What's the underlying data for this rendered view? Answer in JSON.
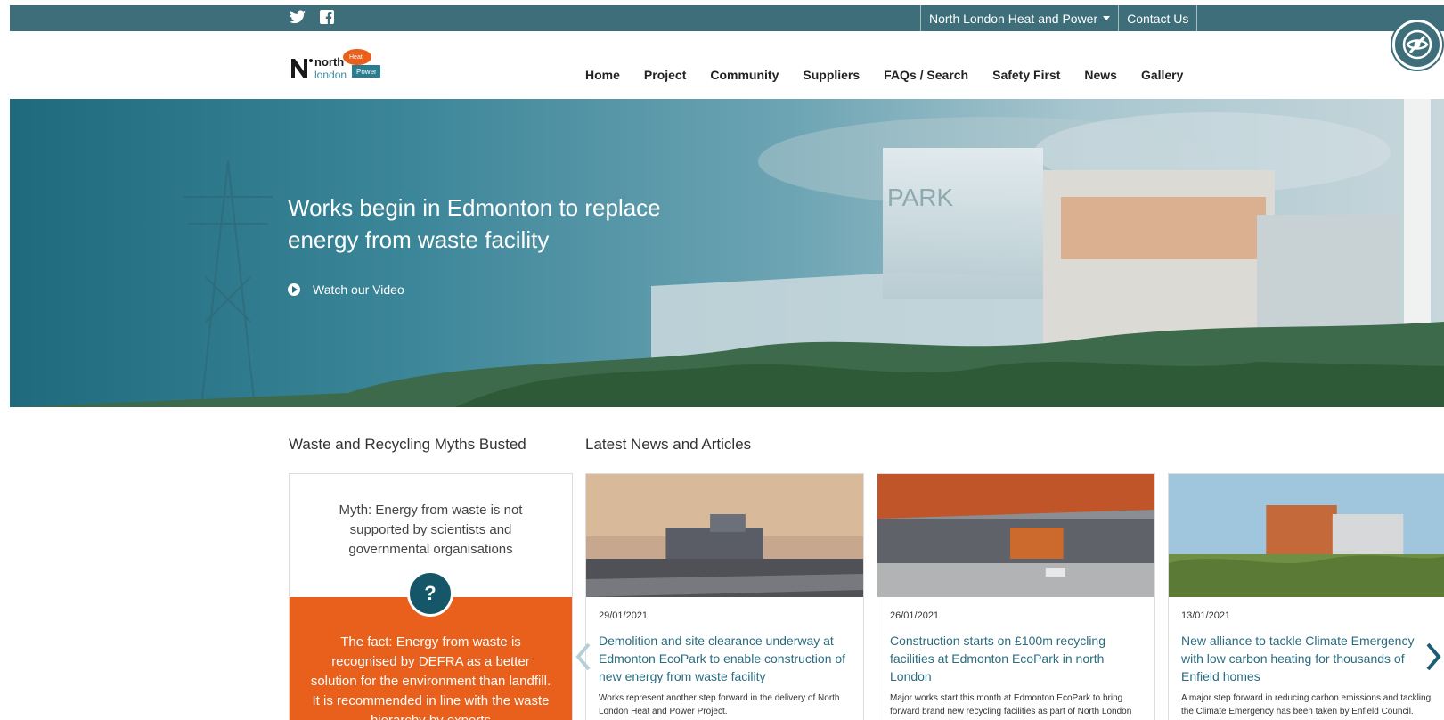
{
  "topbar": {
    "social": [
      "twitter-icon",
      "facebook-icon"
    ],
    "site_menu_label": "North London Heat and Power",
    "contact_label": "Contact Us",
    "accessibility_icon": "eye-slash-icon",
    "color": "#3d6e79"
  },
  "header": {
    "logo_text_1": "north",
    "logo_text_2": "london",
    "logo_badge_1": "Heat",
    "logo_badge_2": "Power",
    "nav": [
      "Home",
      "Project",
      "Community",
      "Suppliers",
      "FAQs / Search",
      "Safety First",
      "News",
      "Gallery"
    ]
  },
  "hero": {
    "title": "Works begin in Edmonton to replace energy from waste facility",
    "video_label": "Watch our Video",
    "building_sign": "PARK"
  },
  "myths": {
    "heading": "Waste and Recycling Myths Busted",
    "myth": "Myth: Energy from waste is not supported by scientists and governmental organisations",
    "badge": "?",
    "fact": "The fact: Energy from waste is recognised by DEFRA as a better solution for the environment than landfill. It is recommended in line with the waste hierarchy by experts",
    "accent": "#e8601c"
  },
  "news": {
    "heading": "Latest News and Articles",
    "items": [
      {
        "date": "29/01/2021",
        "title": "Demolition and site clearance underway at Edmonton EcoPark to enable construction of new energy from waste facility",
        "text": "Works represent another step forward in the delivery of North London Heat and Power Project."
      },
      {
        "date": "26/01/2021",
        "title": "Construction starts on £100m recycling facilities at Edmonton EcoPark in north London",
        "text": "Major works start this month at Edmonton EcoPark to bring forward brand new recycling facilities as part of North London Waste Authority’s (NLWA) plan for a new sustainable waste hub, the North London Heat and Power Project."
      },
      {
        "date": "13/01/2021",
        "title": "New alliance to tackle Climate Emergency with low carbon heating for thousands of Enfield homes",
        "text": "A major step forward in reducing carbon emissions and tackling the Climate Emergency has been taken by Enfield Council."
      }
    ],
    "prev_icon": "chevron-left-icon",
    "next_icon": "chevron-right-icon"
  }
}
